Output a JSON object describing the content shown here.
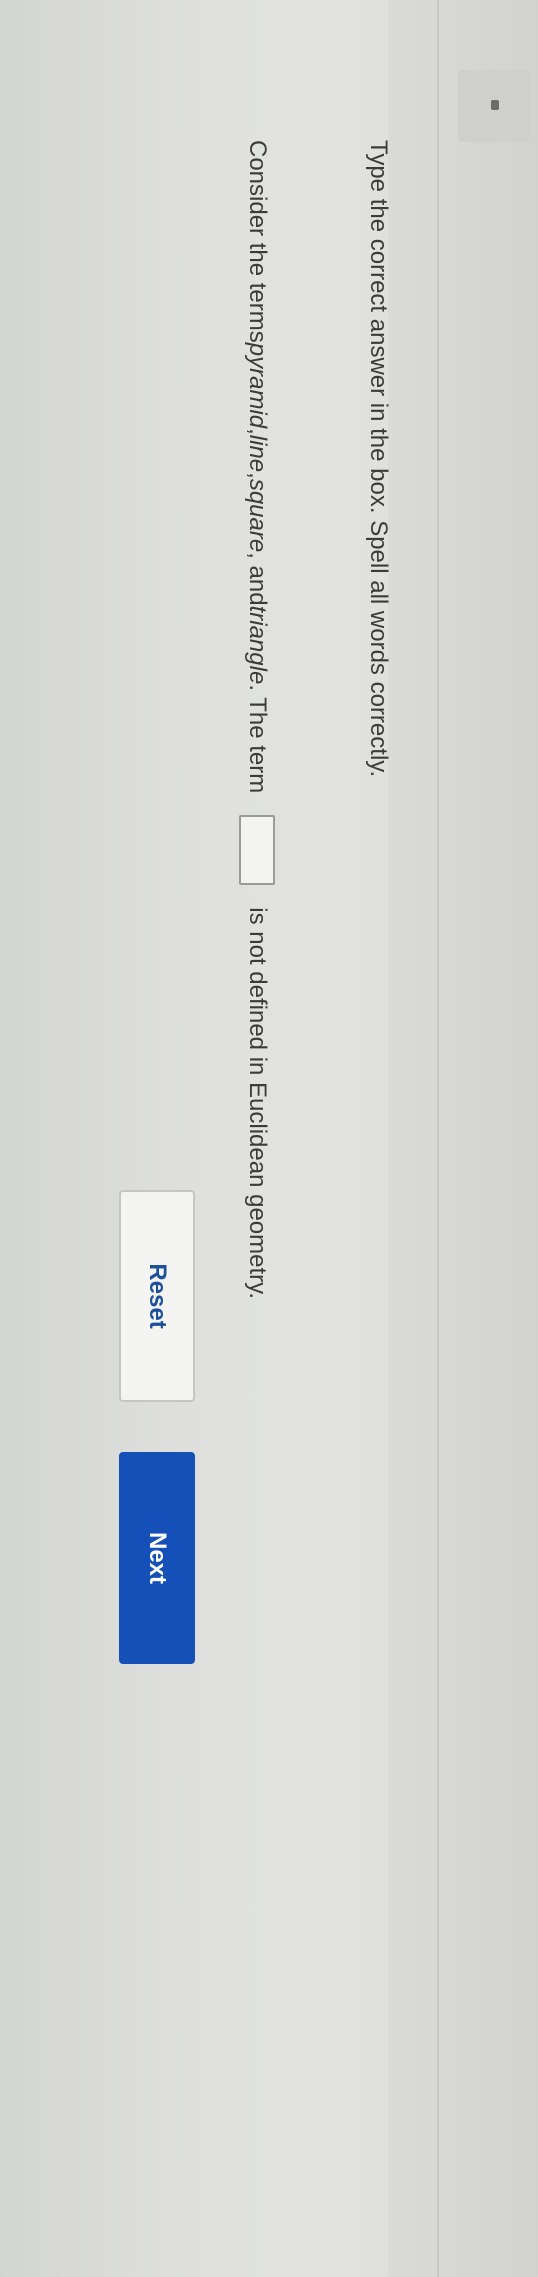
{
  "instruction": "Type the correct answer in the box. Spell all words correctly.",
  "question": {
    "prefix": "Consider the terms ",
    "term1": "pyramid",
    "sep1": ", ",
    "term2": "line",
    "sep2": ", ",
    "term3": "square",
    "sep3": ", and ",
    "term4": "triangle",
    "mid": ". The term",
    "answer_value": "",
    "suffix": "is not defined in Euclidean geometry."
  },
  "buttons": {
    "reset_label": "Reset",
    "next_label": "Next"
  },
  "colors": {
    "accent": "#1550b8",
    "reset_text": "#1d4f9a"
  }
}
